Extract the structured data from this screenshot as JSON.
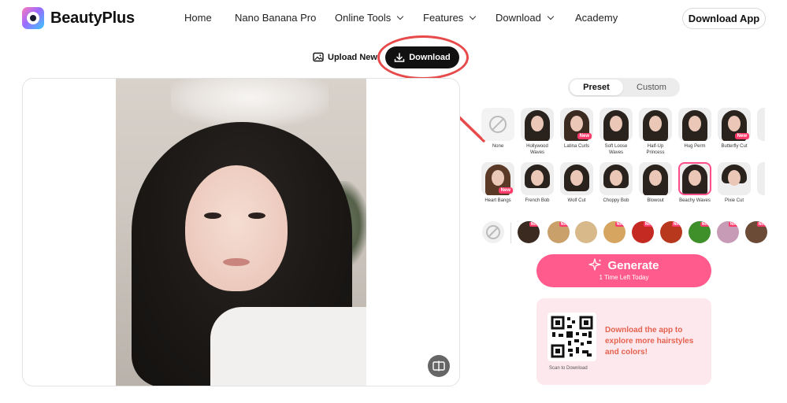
{
  "brand": {
    "name": "BeautyPlus"
  },
  "nav": {
    "items": [
      {
        "label": "Home",
        "has_dropdown": false
      },
      {
        "label": "Nano Banana Pro",
        "has_dropdown": false
      },
      {
        "label": "Online Tools",
        "has_dropdown": true
      },
      {
        "label": "Features",
        "has_dropdown": true
      },
      {
        "label": "Download",
        "has_dropdown": true
      },
      {
        "label": "Academy",
        "has_dropdown": false
      }
    ],
    "cta_label": "Download App"
  },
  "toolbar": {
    "upload_label": "Upload New",
    "download_label": "Download"
  },
  "panel": {
    "tabs": {
      "preset": "Preset",
      "custom": "Custom"
    },
    "active_tab": "Preset",
    "styles_row1": [
      {
        "label": "None",
        "is_new": false,
        "icon": "none-icon"
      },
      {
        "label": "Hollywood Waves",
        "is_new": false
      },
      {
        "label": "Latina Curls",
        "is_new": true
      },
      {
        "label": "Soft Loose Waves",
        "is_new": false
      },
      {
        "label": "Half-Up Princess",
        "is_new": false
      },
      {
        "label": "Hug Perm",
        "is_new": false
      },
      {
        "label": "Butterfly Cut",
        "is_new": true
      }
    ],
    "styles_row2": [
      {
        "label": "Heart Bangs",
        "is_new": true
      },
      {
        "label": "French Bob",
        "is_new": false
      },
      {
        "label": "Wolf Cut",
        "is_new": false
      },
      {
        "label": "Choppy Bob",
        "is_new": false
      },
      {
        "label": "Blowout",
        "is_new": false
      },
      {
        "label": "Beachy Waves",
        "is_new": false,
        "selected": true
      },
      {
        "label": "Pixie Cut",
        "is_new": false
      }
    ],
    "colors": [
      {
        "name": "none",
        "new": false
      },
      {
        "name": "black-blonde",
        "new": true,
        "hex": "#3a2a20"
      },
      {
        "name": "honey-blonde",
        "new": true,
        "hex": "#c9a06a"
      },
      {
        "name": "ash-blonde",
        "new": false,
        "hex": "#d8b98a"
      },
      {
        "name": "golden",
        "new": true,
        "hex": "#d6a55f"
      },
      {
        "name": "red",
        "new": true,
        "hex": "#c42a22"
      },
      {
        "name": "copper-red",
        "new": true,
        "hex": "#b8381e"
      },
      {
        "name": "green",
        "new": true,
        "hex": "#3f8f2a"
      },
      {
        "name": "pastel",
        "new": true,
        "hex": "#c79bb6"
      },
      {
        "name": "dark-brown",
        "new": true,
        "hex": "#6b4a36"
      }
    ],
    "generate_label": "Generate",
    "generate_sub": "1 Time Left Today",
    "promo_text": "Download the app to explore more hairstyles and colors!",
    "qr_caption": "Scan to Download"
  },
  "colors": {
    "accent": "#ff5c8d",
    "annotation": "#e74a4a",
    "promo_bg": "#fde8ee",
    "promo_text": "#e5624e"
  }
}
